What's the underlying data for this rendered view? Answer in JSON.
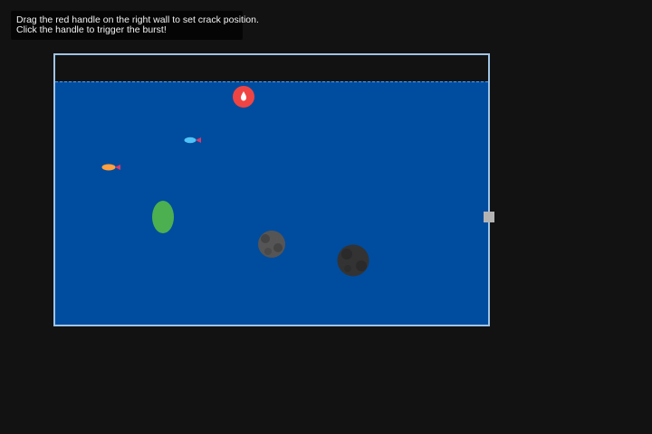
{
  "instructions": {
    "line1": "Drag the red handle on the right wall to set crack position.",
    "line2": "Click the handle to trigger the burst!"
  },
  "colors": {
    "background": "#121212",
    "tank_border": "#9fc4e6",
    "water": "#004c9e",
    "water_surface": "#4da3ff",
    "burst_handle": "#ef4444",
    "crack_handle": "#b3b3b3",
    "plant": "#4caf50",
    "fish_blue": "#4fc3f7",
    "fish_orange": "#ffa040",
    "fish_tail": "#d63a6a",
    "rock_light": "#555555",
    "rock_dark": "#333333"
  },
  "icons": {
    "burst": "droplet-icon"
  }
}
